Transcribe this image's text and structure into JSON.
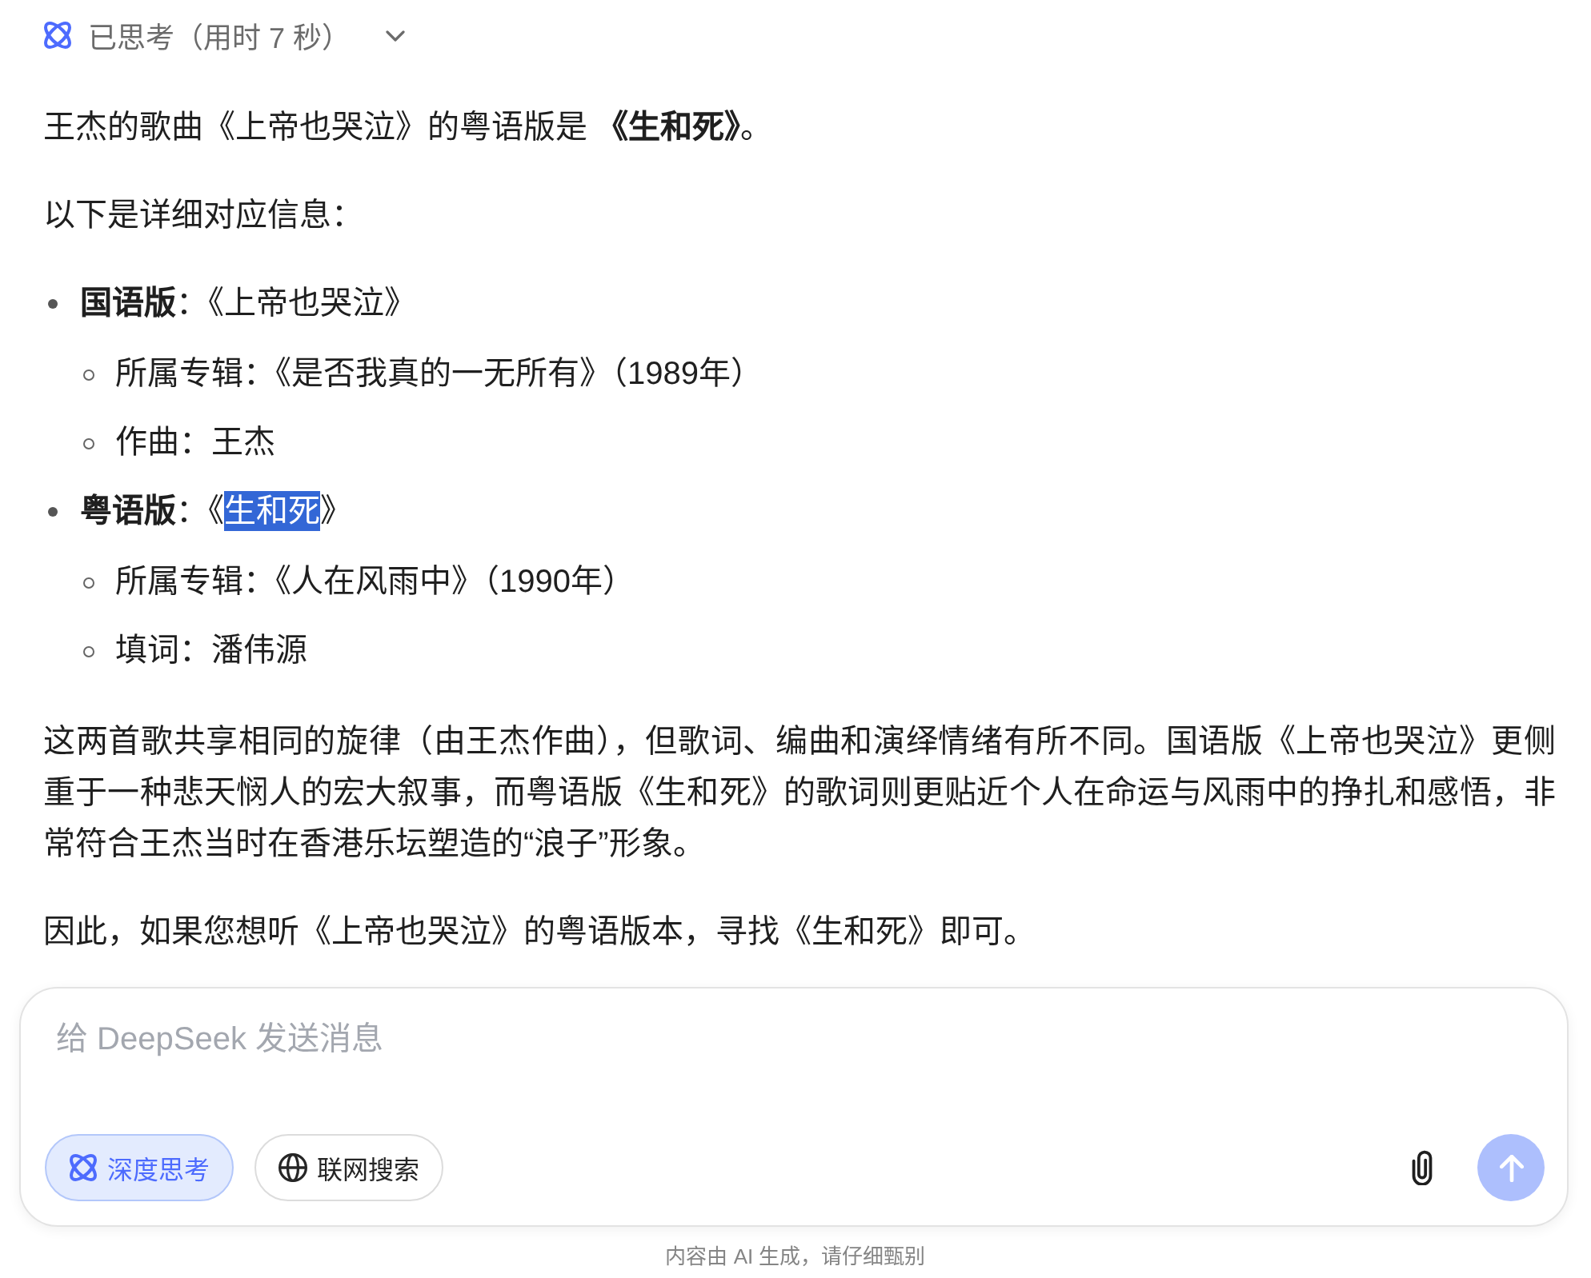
{
  "thinking": {
    "label": "已思考（用时 7 秒）",
    "expanded": false
  },
  "answer": [
    {
      "kind": "paragraph",
      "text": "王杰的歌曲《上帝也哭泣》的粤语版是 **《生和死》**。"
    },
    {
      "kind": "paragraph",
      "text": "以下是详细对应信息："
    },
    {
      "kind": "list",
      "items": [
        {
          "segments": [
            {
              "text": "**国语版**：《上帝也哭泣》",
              "selected": false
            }
          ],
          "children": [
            {
              "segments": [
                {
                  "text": "所属专辑：《是否我真的一无所有》（1989年）",
                  "selected": false
                }
              ]
            },
            {
              "segments": [
                {
                  "text": "作曲：王杰",
                  "selected": false
                }
              ]
            }
          ]
        },
        {
          "segments": [
            {
              "text": "**粤语版**：《",
              "selected": false
            },
            {
              "text": "生和死",
              "selected": true
            },
            {
              "text": "》",
              "selected": false
            }
          ],
          "children": [
            {
              "segments": [
                {
                  "text": "所属专辑：《人在风雨中》（1990年）",
                  "selected": false
                }
              ]
            },
            {
              "segments": [
                {
                  "text": "填词：潘伟源",
                  "selected": false
                }
              ]
            }
          ]
        }
      ]
    },
    {
      "kind": "paragraph",
      "text": "这两首歌共享相同的旋律（由王杰作曲），但歌词、编曲和演绎情绪有所不同。国语版《上帝也哭泣》更侧重于一种悲天悯人的宏大叙事，而粤语版《生和死》的歌词则更贴近个人在命运与风雨中的挣扎和感悟，非常符合王杰当时在香港乐坛塑造的“浪子”形象。"
    },
    {
      "kind": "paragraph",
      "text": "因此，如果您想听《上帝也哭泣》的粤语版本，寻找《生和死》即可。"
    }
  ],
  "composer": {
    "placeholder": "给 DeepSeek 发送消息",
    "toggles": [
      {
        "kind": "think",
        "label": "深度思考",
        "selected": true
      },
      {
        "kind": "search",
        "label": "联网搜索",
        "selected": false
      }
    ],
    "send_button": {
      "disabled": true
    }
  },
  "footer": "内容由 AI 生成，请仔细甄别"
}
